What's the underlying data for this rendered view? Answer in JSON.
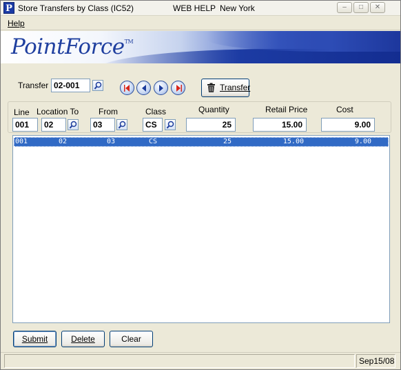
{
  "titlebar": {
    "app_icon_letter": "P",
    "title": "Store Transfers by Class (IC52)",
    "web_help": "WEB HELP",
    "location": "New York",
    "minimize_glyph": "–",
    "maximize_glyph": "□",
    "close_glyph": "✕"
  },
  "menu": {
    "help": "Help"
  },
  "banner": {
    "logo_text": "PointForce",
    "logo_tm": "TM"
  },
  "transfer": {
    "label": "Transfer",
    "value": "02-001"
  },
  "toolbar": {
    "transfer_button": "Transfer"
  },
  "fields": {
    "line": {
      "label": "Line",
      "value": "001"
    },
    "location_to": {
      "label": "Location To",
      "value": "02"
    },
    "from": {
      "label": "From",
      "value": "03"
    },
    "class": {
      "label": "Class",
      "value": "CS"
    },
    "quantity": {
      "label": "Quantity",
      "value": "25"
    },
    "retail_price": {
      "label": "Retail Price",
      "value": "15.00"
    },
    "cost": {
      "label": "Cost",
      "value": "9.00"
    }
  },
  "list": {
    "rows": [
      {
        "line": "001",
        "location_to": "02",
        "from": "03",
        "class": "CS",
        "quantity": "25",
        "retail_price": "15.00",
        "cost": "9.00",
        "selected": true
      }
    ]
  },
  "buttons": {
    "submit": "Submit",
    "delete": "Delete",
    "clear": "Clear"
  },
  "status": {
    "message": "",
    "date": "Sep15/08"
  },
  "colors": {
    "selection": "#316ac5",
    "logo_blue": "#1f3f9f",
    "nav_arrow_red": "#d8261a",
    "nav_arrow_blue": "#1c3c9c"
  }
}
